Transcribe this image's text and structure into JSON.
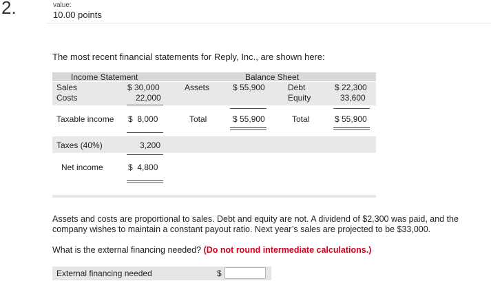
{
  "question": {
    "number": "2.",
    "value_label": "value:",
    "points": "10.00 points",
    "intro": "The most recent financial statements for Reply, Inc., are shown here:",
    "paragraph1": "Assets and costs are proportional to sales. Debt and equity are not. A dividend of $2,300 was paid, and the",
    "paragraph2": "company wishes to maintain a constant payout ratio. Next year’s sales are projected to be $33,000.",
    "prompt": "What is the external financing needed?",
    "instruction": "(Do not round intermediate calculations.)"
  },
  "income_statement": {
    "title": "Income Statement",
    "sales_label": "Sales",
    "sales_value": "$ 30,000",
    "costs_label": "Costs",
    "costs_value": "22,000",
    "taxable_label": "Taxable income",
    "taxable_value": "$  8,000",
    "taxes_label": "Taxes (40%)",
    "taxes_value": "3,200",
    "net_label": "Net income",
    "net_value": "$  4,800"
  },
  "balance_sheet": {
    "title": "Balance Sheet",
    "assets_label": "Assets",
    "assets_value": "$ 55,900",
    "debt_label": "Debt",
    "debt_value": "$ 22,300",
    "equity_label": "Equity",
    "equity_value": "33,600",
    "total_left_label": "Total",
    "total_left_value": "$ 55,900",
    "total_right_label": "Total",
    "total_right_value": "$ 55,900"
  },
  "answer": {
    "label": "External financing needed",
    "currency": "$",
    "value": ""
  }
}
